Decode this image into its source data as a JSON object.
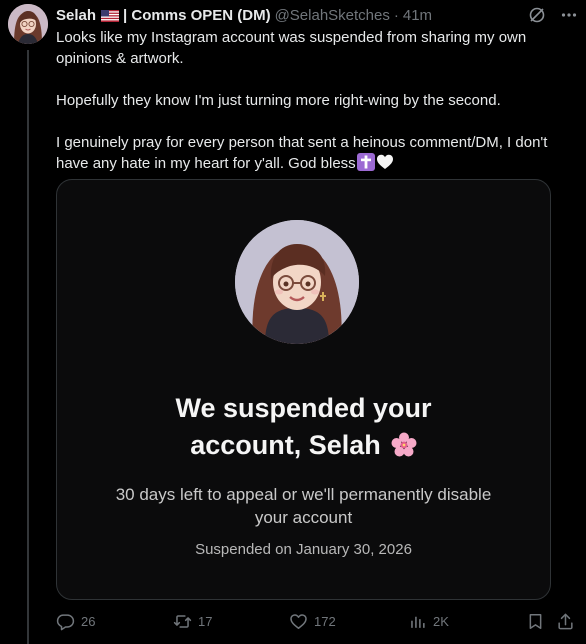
{
  "tweet": {
    "author": {
      "display_name": "Selah",
      "name_suffix": "| Comms OPEN (DM)",
      "handle": "@SelahSketches",
      "separator": "·",
      "time": "41m",
      "flag_icon": "us-flag-icon"
    },
    "text": {
      "line1": "Looks like my Instagram account was suspended from sharing my own opinions & artwork.",
      "line2": "Hopefully they know I'm just turning more right-wing by the second.",
      "line3": "I genuinely pray for every person that sent a heinous comment/DM, I don't have any hate in my heart for y'all. God bless"
    },
    "emojis": [
      "latin-cross-emoji",
      "white-heart-emoji"
    ],
    "media": {
      "title_line1": "We suspended your",
      "title_line2": "account, Selah",
      "title_emoji": "cherry-blossom-emoji",
      "subtitle": "30 days left to appeal or we'll permanently disable your account",
      "date": "Suspended on January 30, 2026"
    },
    "actions": {
      "replies": "26",
      "reposts": "17",
      "likes": "172",
      "views": "2K"
    },
    "icons": {
      "grok": "grok-icon",
      "more": "more-icon",
      "reply": "reply-icon",
      "repost": "repost-icon",
      "like": "heart-icon",
      "views": "views-icon",
      "bookmark": "bookmark-icon",
      "share": "share-icon"
    }
  },
  "colors": {
    "background": "#000000",
    "text_primary": "#e7e9ea",
    "text_secondary": "#71767b",
    "border": "#2f3336"
  }
}
